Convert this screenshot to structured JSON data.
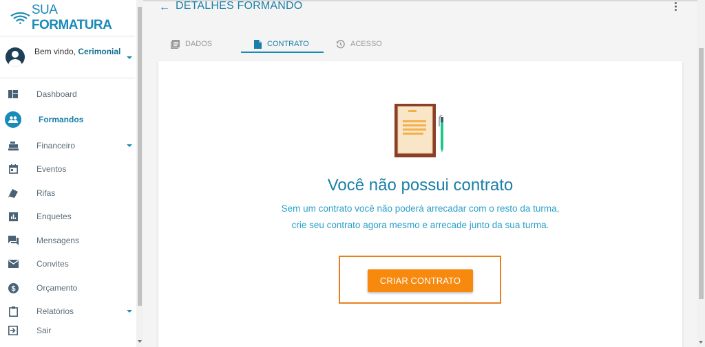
{
  "brand": {
    "name_light": "SUA ",
    "name_bold": "FORMATURA",
    "color": "#1a8ab8"
  },
  "user": {
    "welcome_prefix": "Bem vindo, ",
    "name": "Cerimonial"
  },
  "sidebar": {
    "items": [
      {
        "label": "Dashboard",
        "icon": "dashboard-icon"
      },
      {
        "label": "Formandos",
        "icon": "people-icon",
        "active": true
      },
      {
        "label": "Financeiro",
        "icon": "cash-register-icon",
        "expandable": true
      },
      {
        "label": "Eventos",
        "icon": "calendar-icon"
      },
      {
        "label": "Rifas",
        "icon": "ticket-icon"
      },
      {
        "label": "Enquetes",
        "icon": "poll-icon"
      },
      {
        "label": "Mensagens",
        "icon": "chat-icon"
      },
      {
        "label": "Convites",
        "icon": "mail-icon"
      },
      {
        "label": "Orçamento",
        "icon": "dollar-icon"
      },
      {
        "label": "Relatórios",
        "icon": "clipboard-icon",
        "expandable": true
      },
      {
        "label": "Sair",
        "icon": "logout-icon"
      }
    ]
  },
  "header": {
    "title": "DETALHES FORMANDO"
  },
  "tabs": [
    {
      "label": "DADOS",
      "icon": "list-icon"
    },
    {
      "label": "CONTRATO",
      "icon": "document-icon",
      "active": true
    },
    {
      "label": "ACESSO",
      "icon": "history-icon"
    }
  ],
  "empty_state": {
    "title": "Você não possui contrato",
    "line1": "Sem um contrato você não poderá arrecadar com o resto da turma,",
    "line2": "crie seu contrato agora mesmo e arrecade junto da sua turma.",
    "button": "CRIAR CONTRATO"
  },
  "colors": {
    "primary": "#1a8ab8",
    "accent": "#f7890f",
    "highlight": "#e6801f"
  }
}
